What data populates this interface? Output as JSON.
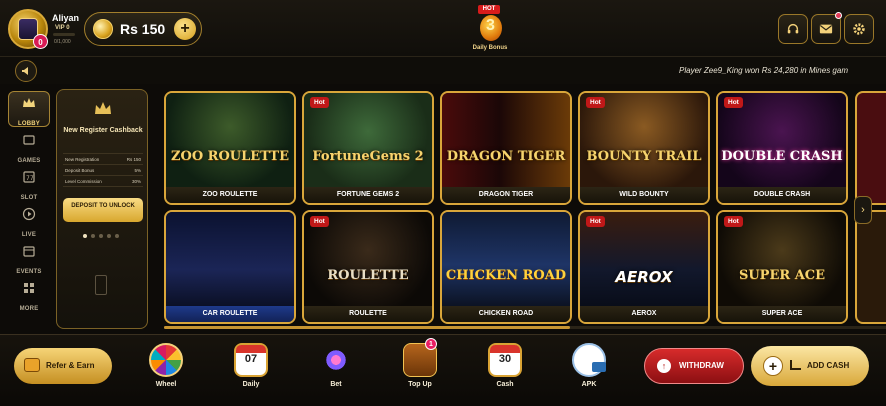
{
  "header": {
    "username": "Aliyan",
    "vip_label": "VIP 0",
    "vip_progress_text": "0/1,000",
    "avatar_level": "0",
    "balance": "Rs 150",
    "balance_plus": "+",
    "daily_bonus": {
      "badge": "HOT",
      "label": "Daily Bonus"
    },
    "icons": [
      "headset-icon",
      "mail-icon",
      "gear-icon"
    ]
  },
  "marquee": {
    "text": "Player Zee9_King won Rs 24,280 in Mines gam"
  },
  "sidebar": {
    "items": [
      {
        "label": "LOBBY",
        "icon": "crown-icon",
        "active": true
      },
      {
        "label": "GAMES",
        "icon": "card-icon"
      },
      {
        "label": "SLOT",
        "icon": "slot-icon"
      },
      {
        "label": "LIVE",
        "icon": "play-icon"
      },
      {
        "label": "EVENTS",
        "icon": "calendar-icon"
      },
      {
        "label": "MORE",
        "icon": "grid-icon"
      }
    ]
  },
  "cashback": {
    "title": "New Register Cashback",
    "rows": [
      {
        "label": "New Registration",
        "value": "Rs 150"
      },
      {
        "label": "Deposit Bonus",
        "value": "5%"
      },
      {
        "label": "Level Commission",
        "value": "30%"
      }
    ],
    "button": "DEPOSIT TO UNLOCK"
  },
  "games": [
    {
      "name": "ZOO ROULETTE",
      "hot": false,
      "art_text": "ZOO ROULETTE"
    },
    {
      "name": "FORTUNE GEMS 2",
      "hot": true,
      "art_text": "FortuneGems 2"
    },
    {
      "name": "DRAGON TIGER",
      "hot": false,
      "art_text": "DRAGON TIGER"
    },
    {
      "name": "WILD BOUNTY",
      "hot": true,
      "art_text": "BOUNTY TRAIL"
    },
    {
      "name": "DOUBLE CRASH",
      "hot": true,
      "art_text": "DOUBLE CRASH"
    },
    {
      "name": "CAR ROULETTE",
      "hot": false,
      "art_text": ""
    },
    {
      "name": "ROULETTE",
      "hot": true,
      "art_text": "ROULETTE"
    },
    {
      "name": "CHICKEN ROAD",
      "hot": false,
      "art_text": "CHICKEN ROAD"
    },
    {
      "name": "AEROX",
      "hot": true,
      "art_text": "AEROX"
    },
    {
      "name": "SUPER ACE",
      "hot": true,
      "art_text": "SUPER ACE"
    }
  ],
  "hot_label": "Hot",
  "bottom": {
    "refer": "Refer & Earn",
    "quick": [
      {
        "label": "Wheel"
      },
      {
        "label": "Daily",
        "num": "07"
      },
      {
        "label": "Bet"
      },
      {
        "label": "Top Up",
        "badge": "1"
      },
      {
        "label": "Cash",
        "num": "30"
      },
      {
        "label": "APK"
      }
    ],
    "withdraw": "WITHDRAW",
    "add_cash": "ADD CASH"
  }
}
